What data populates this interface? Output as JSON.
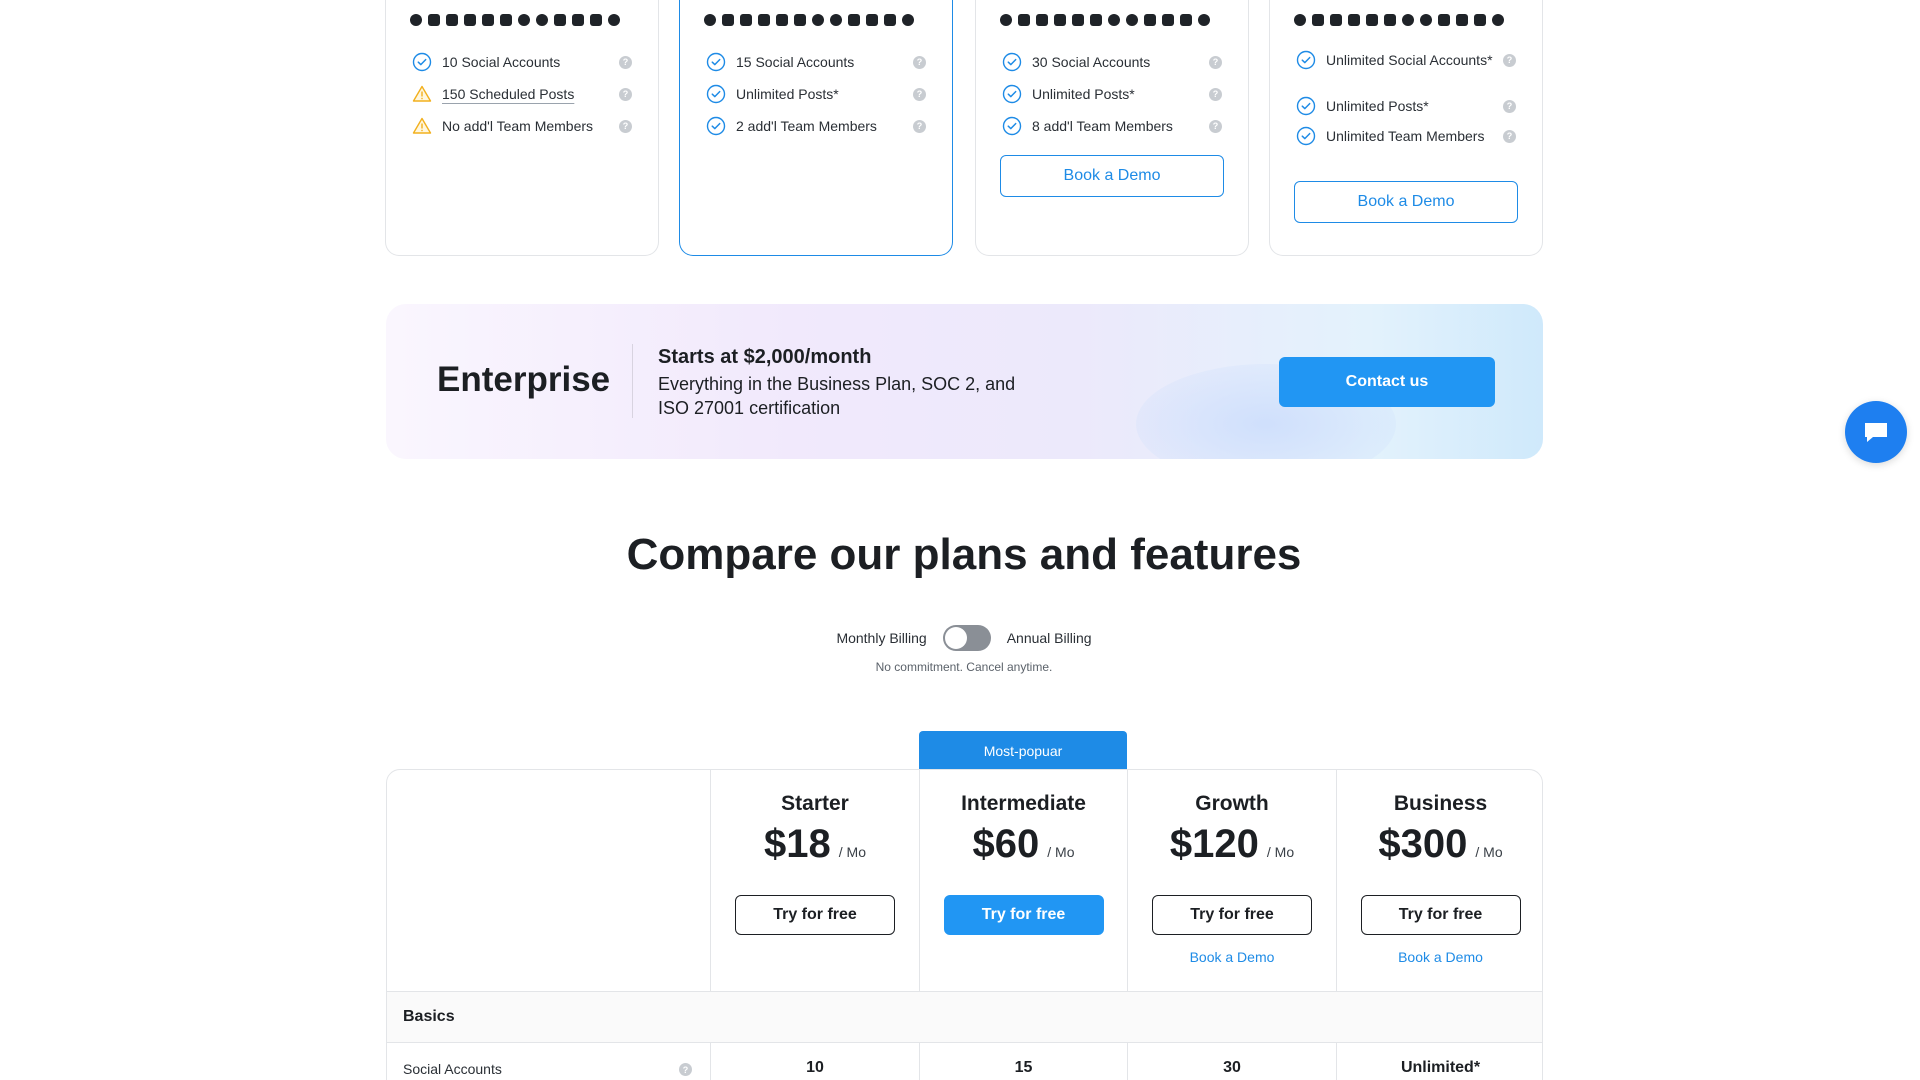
{
  "plan_cards": [
    {
      "features": [
        {
          "icon": "check-circle-icon",
          "text": "10 Social Accounts",
          "underline": false
        },
        {
          "icon": "warning-icon",
          "text": "150 Scheduled Posts",
          "underline": true
        },
        {
          "icon": "warning-icon",
          "text": "No add'l Team Members",
          "underline": false
        }
      ]
    },
    {
      "features": [
        {
          "icon": "check-circle-icon",
          "text": "15 Social Accounts"
        },
        {
          "icon": "check-circle-icon",
          "text": "Unlimited Posts*"
        },
        {
          "icon": "check-circle-icon",
          "text": "2 add'l Team Members"
        }
      ]
    },
    {
      "features": [
        {
          "icon": "check-circle-icon",
          "text": "30 Social Accounts"
        },
        {
          "icon": "check-circle-icon",
          "text": "Unlimited Posts*"
        },
        {
          "icon": "check-circle-icon",
          "text": "8 add'l Team Members"
        }
      ],
      "demo_label": "Book a Demo"
    },
    {
      "features": [
        {
          "icon": "check-circle-icon",
          "text": "Unlimited Social Accounts*"
        },
        {
          "icon": "check-circle-icon",
          "text": "Unlimited Posts*"
        },
        {
          "icon": "check-circle-icon",
          "text": "Unlimited Team Members"
        }
      ],
      "demo_label": "Book a Demo"
    }
  ],
  "enterprise": {
    "title": "Enterprise",
    "price": "Starts at $2,000/month",
    "description": "Everything in the Business Plan, SOC 2, and ISO 27001 certification",
    "cta": "Contact us"
  },
  "compare": {
    "title": "Compare our plans and features",
    "billing_monthly": "Monthly Billing",
    "billing_annual": "Annual Billing",
    "no_commitment": "No commitment. Cancel anytime.",
    "popular_tag": "Most-popuar"
  },
  "plans": [
    {
      "name": "Starter",
      "price": "$18",
      "per": "/ Mo",
      "cta": "Try for free"
    },
    {
      "name": "Intermediate",
      "price": "$60",
      "per": "/ Mo",
      "cta": "Try for free"
    },
    {
      "name": "Growth",
      "price": "$120",
      "per": "/ Mo",
      "cta": "Try for free",
      "demo": "Book a Demo"
    },
    {
      "name": "Business",
      "price": "$300",
      "per": "/ Mo",
      "cta": "Try for free",
      "demo": "Book a Demo"
    }
  ],
  "table": {
    "section": "Basics",
    "rows": [
      {
        "label": "Social Accounts",
        "values": [
          "10",
          "15",
          "30",
          "Unlimited*"
        ]
      }
    ]
  },
  "colors": {
    "accent": "#1e8be6",
    "primary_button": "#2196f3",
    "warning": "#f2b01e"
  }
}
